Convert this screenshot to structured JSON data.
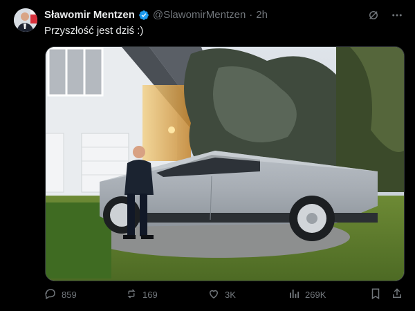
{
  "author": {
    "name": "Sławomir Mentzen",
    "handle": "@SlawomirMentzen",
    "separator": "·",
    "time": "2h"
  },
  "tweet": {
    "text": "Przyszłość jest dziś :)"
  },
  "actions": {
    "replies": "859",
    "reposts": "169",
    "likes": "3K",
    "views": "269K"
  },
  "icons": {
    "verified": "verified-badge-icon",
    "grok": "grok-icon",
    "more": "more-icon",
    "reply": "reply-icon",
    "repost": "repost-icon",
    "like": "heart-icon",
    "views": "views-icon",
    "bookmark": "bookmark-icon",
    "share": "share-icon"
  },
  "colors": {
    "background": "#000000",
    "text": "#e7e9ea",
    "muted": "#71767b",
    "verified": "#1d9bf0"
  }
}
